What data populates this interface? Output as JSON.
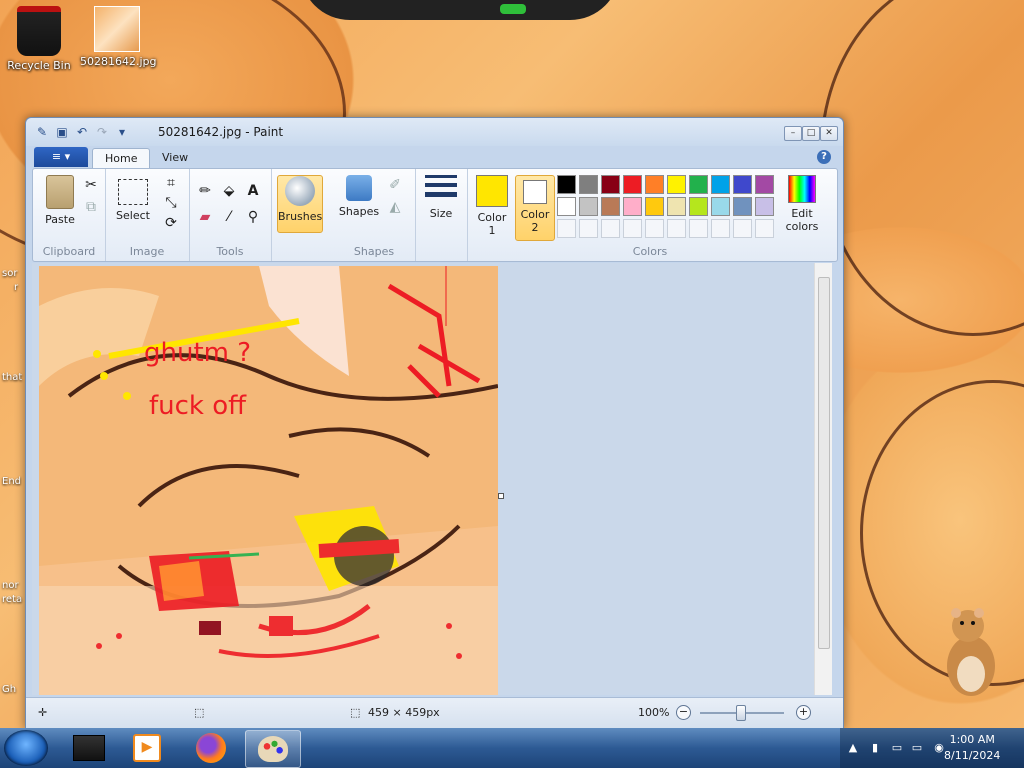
{
  "desktop": {
    "icons": [
      {
        "label": "Recycle Bin",
        "icon": "recycle-bin-icon"
      },
      {
        "label": "50281642.jpg",
        "icon": "image-file-icon"
      }
    ],
    "edge_labels": [
      "sor",
      "r",
      "that",
      "End",
      "nor",
      "reta",
      "Gh"
    ]
  },
  "window": {
    "title": "50281642.jpg - Paint",
    "controls": {
      "minimize": "–",
      "maximize": "□",
      "close": "✕"
    }
  },
  "ribbon": {
    "file_menu": "≡ ▾",
    "tabs": [
      {
        "label": "Home",
        "active": true
      },
      {
        "label": "View",
        "active": false
      }
    ],
    "help": "?",
    "groups": {
      "clipboard": {
        "label": "Clipboard",
        "paste": "Paste"
      },
      "image": {
        "label": "Image",
        "select": "Select"
      },
      "tools": {
        "label": "Tools"
      },
      "brushes": {
        "label": "Brushes"
      },
      "shapes": {
        "label": "Shapes",
        "button": "Shapes"
      },
      "size": {
        "label": "Size"
      },
      "colors": {
        "label": "Colors",
        "color1": "Color\n1",
        "color2": "Color\n2",
        "color1_value": "#ffe600",
        "color2_value": "#ffffff",
        "edit_colors": "Edit\ncolors",
        "palette": [
          "#000000",
          "#7f7f7f",
          "#880015",
          "#ed1c24",
          "#ff7f27",
          "#fff200",
          "#22b14c",
          "#00a2e8",
          "#3f48cc",
          "#a349a4",
          "#ffffff",
          "#c3c3c3",
          "#b97a57",
          "#ffaec9",
          "#ffc90e",
          "#efe4b0",
          "#b5e61d",
          "#99d9ea",
          "#7092be",
          "#c8bfe7"
        ]
      }
    }
  },
  "canvas": {
    "annotations": [
      "ghutm ?",
      "fuck off"
    ]
  },
  "statusbar": {
    "dimensions": "459 × 459px",
    "zoom": "100%",
    "zoom_out": "−",
    "zoom_in": "+"
  },
  "taskbar": {
    "time": "1:00 AM",
    "date": "8/11/2024",
    "apps": [
      "terminal",
      "media-player",
      "firefox",
      "paint"
    ]
  }
}
